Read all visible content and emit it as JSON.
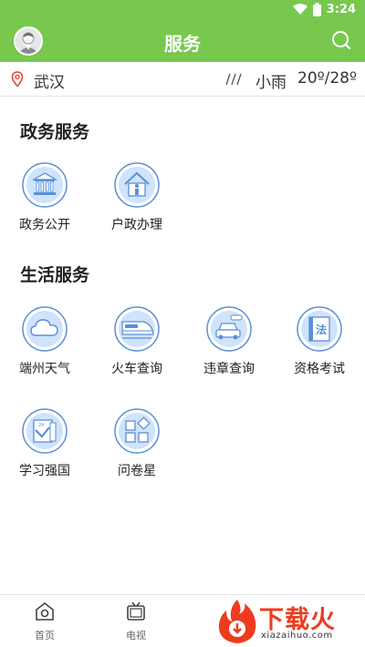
{
  "status_bar": {
    "time": "3:24"
  },
  "app_bar": {
    "title": "服务"
  },
  "location": {
    "city": "武汉",
    "weather": "小雨",
    "temperature": "20º/28º"
  },
  "sections": [
    {
      "title": "政务服务",
      "items": [
        {
          "label": "政务公开",
          "icon": "government-building-icon"
        },
        {
          "label": "户政办理",
          "icon": "household-registration-icon"
        }
      ]
    },
    {
      "title": "生活服务",
      "items": [
        {
          "label": "端州天气",
          "icon": "cloud-icon"
        },
        {
          "label": "火车查询",
          "icon": "train-icon"
        },
        {
          "label": "违章查询",
          "icon": "car-icon"
        },
        {
          "label": "资格考试",
          "icon": "law-book-icon"
        },
        {
          "label": "学习强国",
          "icon": "study-calendar-icon"
        },
        {
          "label": "问卷星",
          "icon": "questionnaire-icon"
        }
      ]
    }
  ],
  "tabs": [
    {
      "label": "首页",
      "icon": "home-camera-icon"
    },
    {
      "label": "电视",
      "icon": "tv-icon"
    }
  ],
  "watermark": {
    "text": "下载火",
    "subtext": "xiazaihuo.com"
  },
  "colors": {
    "primary": "#77c84d",
    "icon_stroke": "#5b8fd6",
    "icon_fill": "#cfe3fb",
    "watermark": "#ee3b1f"
  }
}
